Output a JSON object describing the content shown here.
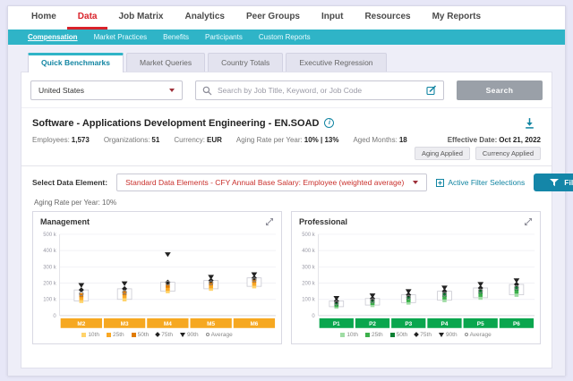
{
  "top_nav": {
    "items": [
      {
        "label": "Home"
      },
      {
        "label": "Data"
      },
      {
        "label": "Job Matrix"
      },
      {
        "label": "Analytics"
      },
      {
        "label": "Peer Groups"
      },
      {
        "label": "Input"
      },
      {
        "label": "Resources"
      },
      {
        "label": "My Reports"
      }
    ]
  },
  "sub_nav": {
    "items": [
      {
        "label": "Compensation"
      },
      {
        "label": "Market Practices"
      },
      {
        "label": "Benefits"
      },
      {
        "label": "Participants"
      },
      {
        "label": "Custom Reports"
      }
    ]
  },
  "tabs": [
    {
      "label": "Quick Benchmarks"
    },
    {
      "label": "Market Queries"
    },
    {
      "label": "Country Totals"
    },
    {
      "label": "Executive Regression"
    }
  ],
  "search": {
    "country_value": "United States",
    "placeholder": "Search by Job Title, Keyword, or Job Code",
    "search_button": "Search"
  },
  "job_header": {
    "title": "Software - Applications Development Engineering - EN.SOAD",
    "meta": [
      {
        "label": "Employees:",
        "value": "1,573"
      },
      {
        "label": "Organizations:",
        "value": "51"
      },
      {
        "label": "Currency:",
        "value": "EUR"
      },
      {
        "label": "Aging Rate per Year:",
        "value": "10% | 13%"
      },
      {
        "label": "Aged Months:",
        "value": "18"
      }
    ],
    "effective_date_label": "Effective Date:",
    "effective_date_value": "Oct 21, 2022",
    "badges": [
      {
        "label": "Aging Applied"
      },
      {
        "label": "Currency Applied"
      }
    ]
  },
  "data_element": {
    "label": "Select Data Element:",
    "selected": "Standard Data Elements - CFY Annual Base Salary: Employee (weighted average)",
    "active_filters_link": "Active Filter Selections",
    "filters_button": "Filters"
  },
  "aging_note": "Aging Rate per Year: 10%",
  "colors": {
    "brand_red": "#d9222a",
    "teal_bar": "#2fb4c7",
    "link_teal": "#1285a2",
    "filters_button": "#1486a8",
    "management_axis": "#f6a821",
    "professional_axis": "#0aa64e"
  },
  "chart_data": [
    {
      "type": "boxplot",
      "title": "Management",
      "categories": [
        "M2",
        "M3",
        "M4",
        "M5",
        "M6"
      ],
      "series": [
        {
          "name": "10th",
          "values": [
            90,
            100,
            150,
            165,
            180
          ]
        },
        {
          "name": "25th",
          "values": [
            108,
            120,
            165,
            180,
            196
          ]
        },
        {
          "name": "50th",
          "values": [
            126,
            138,
            184,
            198,
            214
          ]
        },
        {
          "name": "75th",
          "values": [
            158,
            165,
            205,
            216,
            232
          ]
        },
        {
          "name": "90th",
          "values": [
            186,
            196,
            375,
            236,
            252
          ]
        },
        {
          "name": "Average",
          "values": [
            134,
            144,
            200,
            202,
            220
          ]
        }
      ],
      "unit": "k",
      "ylim": [
        0,
        500
      ],
      "yticks": [
        {
          "value": 0,
          "label": "0"
        },
        {
          "value": 100,
          "label": "100 k"
        },
        {
          "value": 200,
          "label": "200 k"
        },
        {
          "value": 300,
          "label": "300 k"
        },
        {
          "value": 400,
          "label": "400 k"
        },
        {
          "value": 500,
          "label": "500 k"
        }
      ],
      "marker_colors": [
        "#ffd36b",
        "#f9a825",
        "#e07b00",
        "#222222",
        "#222222",
        "#8a8a8a"
      ],
      "axis_color": "#f6a821"
    },
    {
      "type": "boxplot",
      "title": "Professional",
      "categories": [
        "P1",
        "P2",
        "P3",
        "P4",
        "P5",
        "P6"
      ],
      "series": [
        {
          "name": "10th",
          "values": [
            55,
            65,
            80,
            95,
            110,
            128
          ]
        },
        {
          "name": "25th",
          "values": [
            65,
            78,
            95,
            112,
            128,
            148
          ]
        },
        {
          "name": "50th",
          "values": [
            75,
            90,
            110,
            130,
            148,
            168
          ]
        },
        {
          "name": "75th",
          "values": [
            90,
            105,
            128,
            150,
            170,
            192
          ]
        },
        {
          "name": "90th",
          "values": [
            106,
            122,
            148,
            170,
            192,
            215
          ]
        },
        {
          "name": "Average",
          "values": [
            78,
            92,
            113,
            132,
            152,
            172
          ]
        }
      ],
      "unit": "k",
      "ylim": [
        0,
        500
      ],
      "yticks": [
        {
          "value": 0,
          "label": "0"
        },
        {
          "value": 100,
          "label": "100 k"
        },
        {
          "value": 200,
          "label": "200 k"
        },
        {
          "value": 300,
          "label": "300 k"
        },
        {
          "value": 400,
          "label": "400 k"
        },
        {
          "value": 500,
          "label": "500 k"
        }
      ],
      "marker_colors": [
        "#9fdca4",
        "#3db04b",
        "#0c7f33",
        "#222222",
        "#222222",
        "#8a8a8a"
      ],
      "axis_color": "#0aa64e"
    }
  ]
}
